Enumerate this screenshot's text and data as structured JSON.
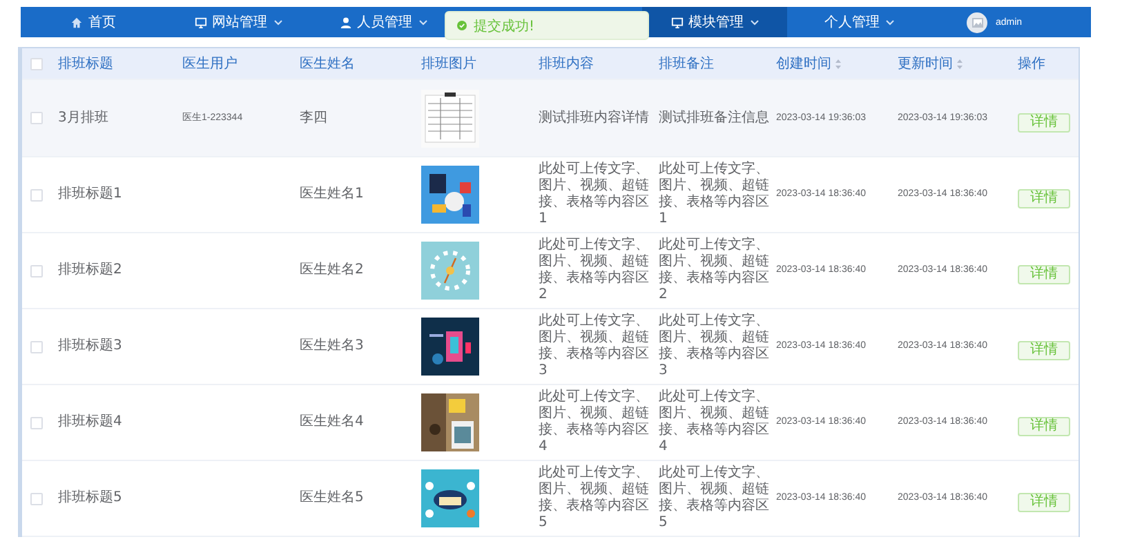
{
  "nav": {
    "items": [
      {
        "label": "首页",
        "kind": "link",
        "selected": false
      },
      {
        "label": "网站管理",
        "kind": "menu",
        "selected": false
      },
      {
        "label": "人员管理",
        "kind": "menu",
        "selected": false
      },
      {
        "label": "模块管理",
        "kind": "menu",
        "selected": true
      },
      {
        "label": "个人管理",
        "kind": "menu",
        "selected": false
      }
    ],
    "user": {
      "name": "admin"
    }
  },
  "toast": {
    "text": "提交成功!"
  },
  "table": {
    "all_checked": false,
    "columns": [
      {
        "label": "排班标题",
        "sortable": false
      },
      {
        "label": "医生用户",
        "sortable": false
      },
      {
        "label": "医生姓名",
        "sortable": false
      },
      {
        "label": "排班图片",
        "sortable": false
      },
      {
        "label": "排班内容",
        "sortable": false
      },
      {
        "label": "排班备注",
        "sortable": false
      },
      {
        "label": "创建时间",
        "sortable": true
      },
      {
        "label": "更新时间",
        "sortable": true
      },
      {
        "label": "操作",
        "sortable": false
      }
    ],
    "rows": [
      {
        "checked": false,
        "hover": true,
        "title": "3月排班",
        "doctor_user": "医生1-223344",
        "doctor_name": "李四",
        "content": "测试排班内容详情",
        "remark": "测试排班备注信息",
        "created": "2023-03-14 19:36:03",
        "updated": "2023-03-14 19:36:03",
        "action": "详情"
      },
      {
        "checked": false,
        "hover": false,
        "title": "排班标题1",
        "doctor_name": "医生姓名1",
        "content": "此处可上传文字、图片、视频、超链接、表格等内容区1",
        "remark": "此处可上传文字、图片、视频、超链接、表格等内容区1",
        "created": "2023-03-14 18:36:40",
        "updated": "2023-03-14 18:36:40",
        "action": "详情"
      },
      {
        "checked": false,
        "hover": false,
        "title": "排班标题2",
        "doctor_name": "医生姓名2",
        "content": "此处可上传文字、图片、视频、超链接、表格等内容区2",
        "remark": "此处可上传文字、图片、视频、超链接、表格等内容区2",
        "created": "2023-03-14 18:36:40",
        "updated": "2023-03-14 18:36:40",
        "action": "详情"
      },
      {
        "checked": false,
        "hover": false,
        "title": "排班标题3",
        "doctor_name": "医生姓名3",
        "content": "此处可上传文字、图片、视频、超链接、表格等内容区3",
        "remark": "此处可上传文字、图片、视频、超链接、表格等内容区3",
        "created": "2023-03-14 18:36:40",
        "updated": "2023-03-14 18:36:40",
        "action": "详情"
      },
      {
        "checked": false,
        "hover": false,
        "title": "排班标题4",
        "doctor_name": "医生姓名4",
        "content": "此处可上传文字、图片、视频、超链接、表格等内容区4",
        "remark": "此处可上传文字、图片、视频、超链接、表格等内容区4",
        "created": "2023-03-14 18:36:40",
        "updated": "2023-03-14 18:36:40",
        "action": "详情"
      },
      {
        "checked": false,
        "hover": false,
        "title": "排班标题5",
        "doctor_name": "医生姓名5",
        "content": "此处可上传文字、图片、视频、超链接、表格等内容区5",
        "remark": "此处可上传文字、图片、视频、超链接、表格等内容区5",
        "created": "2023-03-14 18:36:40",
        "updated": "2023-03-14 18:36:40",
        "action": "详情"
      }
    ]
  }
}
